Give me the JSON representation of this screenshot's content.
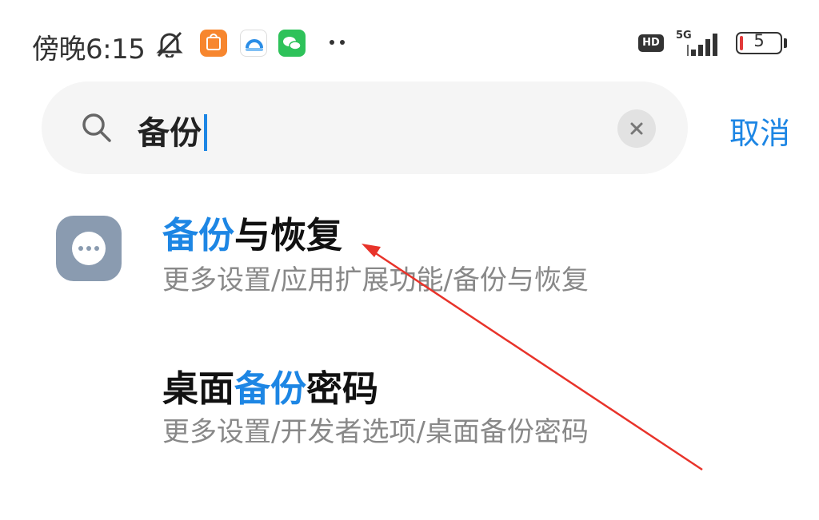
{
  "status_bar": {
    "time": "傍晚6:15",
    "network_type": "5G",
    "hd_label": "HD",
    "battery_level": "5",
    "icons": [
      "mute-icon",
      "mi-store-app-icon",
      "cloud-app-icon",
      "wechat-app-icon",
      "more-notifications-icon",
      "hd-icon",
      "signal-icon",
      "battery-icon"
    ]
  },
  "search": {
    "query": "备份",
    "cancel_label": "取消"
  },
  "results": [
    {
      "title_highlight": "备份",
      "title_rest": "与恢复",
      "path": "更多设置/应用扩展功能/备份与恢复",
      "icon": "more-dots-icon"
    },
    {
      "title_prefix": "桌面",
      "title_highlight": "备份",
      "title_rest": "密码",
      "path": "更多设置/开发者选项/桌面备份密码"
    }
  ],
  "colors": {
    "accent": "#1d86e4",
    "annotation_arrow": "#e8332a",
    "app_icon_bg": "#8a9bb0"
  }
}
